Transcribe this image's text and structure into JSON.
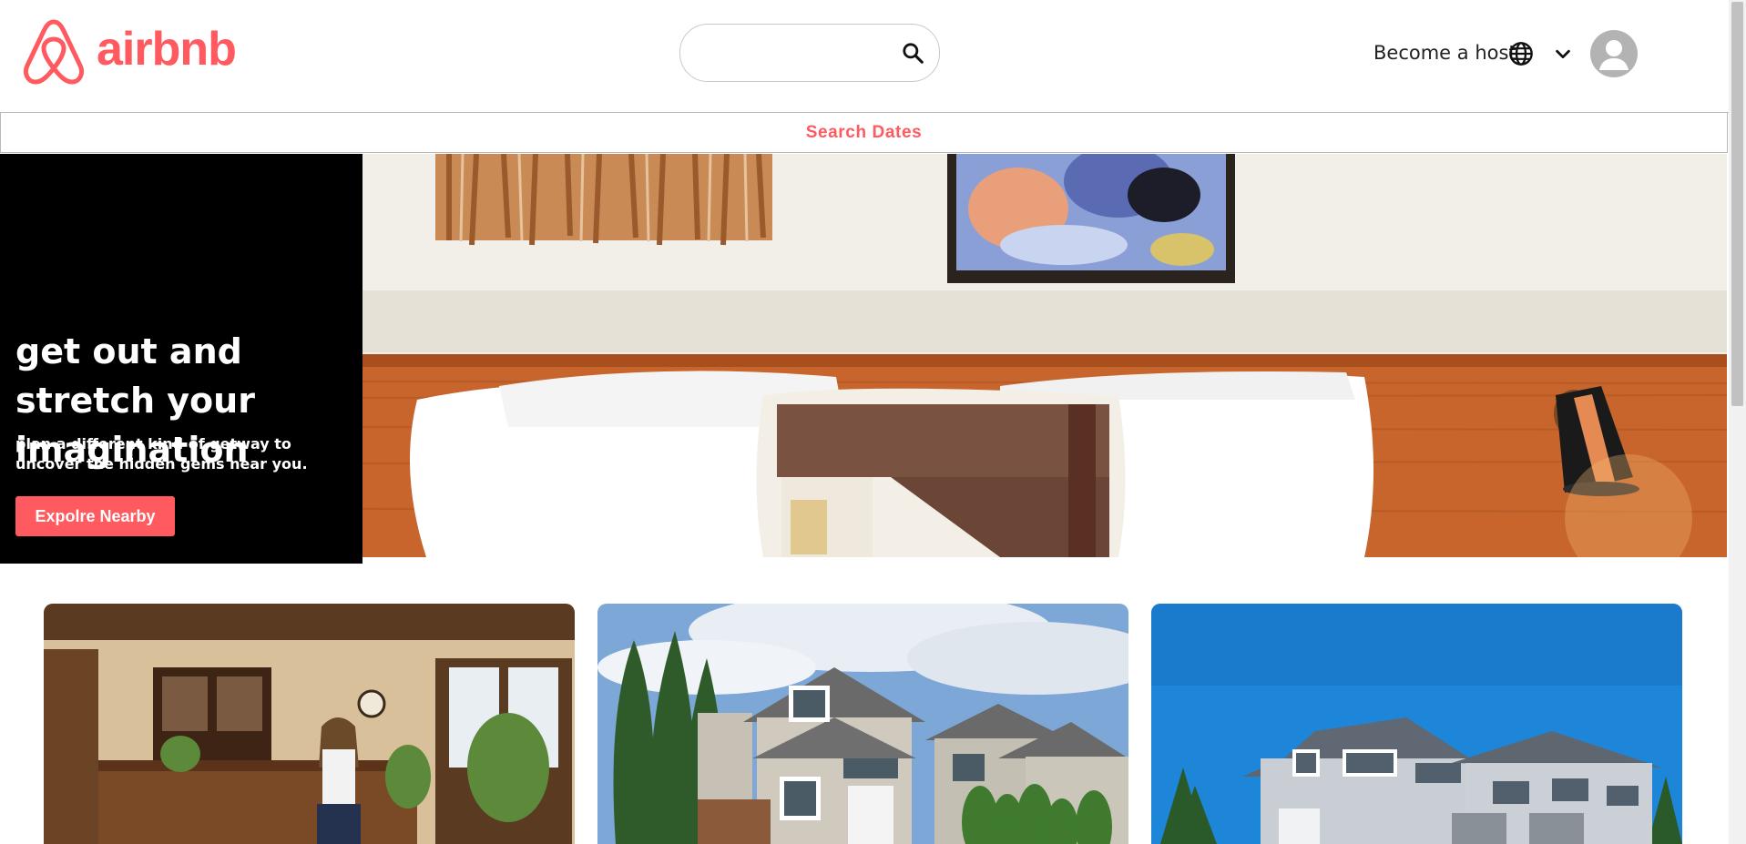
{
  "brand": {
    "name": "airbnb",
    "color": "#ff5a5f"
  },
  "header": {
    "search": {
      "value": "",
      "placeholder": ""
    },
    "become_host_label": "Become a host",
    "icons": [
      "search-icon",
      "globe-icon",
      "chevron-down-icon",
      "user-avatar-icon"
    ]
  },
  "date_bar": {
    "label": "Search Dates"
  },
  "hero": {
    "title": "get out and stretch your imagination",
    "subtitle": "plan a different kind of getway to uncover the hidden gems near you.",
    "button_label": "Expolre Nearby",
    "panel_color": "#000000",
    "button_color": "#ff5a5f"
  },
  "cards": [
    {
      "image": "host-in-dining-room-photo"
    },
    {
      "image": "suburban-house-photo"
    },
    {
      "image": "blue-sky-house-photo"
    }
  ]
}
